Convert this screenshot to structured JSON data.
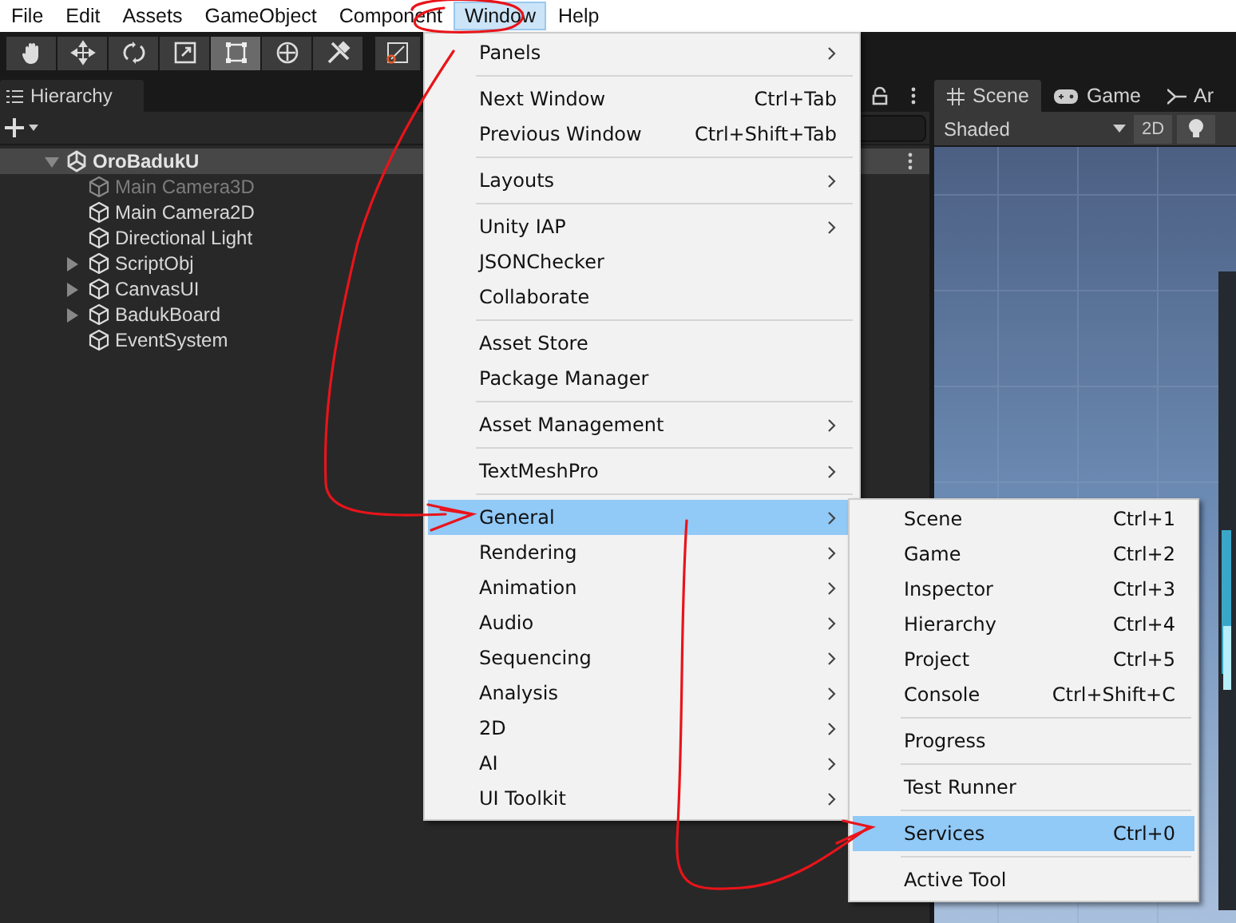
{
  "menubar": [
    {
      "label": "File",
      "selected": false
    },
    {
      "label": "Edit",
      "selected": false
    },
    {
      "label": "Assets",
      "selected": false
    },
    {
      "label": "GameObject",
      "selected": false
    },
    {
      "label": "Component",
      "selected": false
    },
    {
      "label": "Window",
      "selected": true
    },
    {
      "label": "Help",
      "selected": false
    }
  ],
  "toolbar": {
    "tools": [
      {
        "kind": "hand",
        "selected": false
      },
      {
        "kind": "move",
        "selected": false
      },
      {
        "kind": "rotate",
        "selected": false
      },
      {
        "kind": "scale",
        "selected": false
      },
      {
        "kind": "rect",
        "selected": true
      },
      {
        "kind": "transform",
        "selected": false
      },
      {
        "kind": "custom",
        "selected": false
      }
    ]
  },
  "hierarchy": {
    "tab": "Hierarchy",
    "root": {
      "label": "OroBadukU",
      "expanded": true,
      "children": [
        {
          "label": "Main Camera3D",
          "disabled": true,
          "expandable": false
        },
        {
          "label": "Main Camera2D",
          "disabled": false,
          "expandable": false
        },
        {
          "label": "Directional Light",
          "disabled": false,
          "expandable": false
        },
        {
          "label": "ScriptObj",
          "disabled": false,
          "expandable": true
        },
        {
          "label": "CanvasUI",
          "disabled": false,
          "expandable": true
        },
        {
          "label": "BadukBoard",
          "disabled": false,
          "expandable": true
        },
        {
          "label": "EventSystem",
          "disabled": false,
          "expandable": false
        }
      ]
    }
  },
  "scene_view": {
    "tabs": [
      {
        "label": "Scene",
        "kind": "scene",
        "selected": true
      },
      {
        "label": "Game",
        "kind": "game",
        "selected": false
      },
      {
        "label": "Ar",
        "kind": "animator",
        "selected": false
      }
    ],
    "shading": "Shaded",
    "mode_button": "2D"
  },
  "window_menu": {
    "sections": [
      [
        {
          "label": "Panels",
          "submenu": true,
          "selected": false
        }
      ],
      [
        {
          "label": "Next Window",
          "shortcut": "Ctrl+Tab",
          "submenu": false,
          "selected": false
        },
        {
          "label": "Previous Window",
          "shortcut": "Ctrl+Shift+Tab",
          "submenu": false,
          "selected": false
        }
      ],
      [
        {
          "label": "Layouts",
          "submenu": true,
          "selected": false
        }
      ],
      [
        {
          "label": "Unity IAP",
          "submenu": true,
          "selected": false
        },
        {
          "label": "JSONChecker",
          "submenu": false,
          "selected": false
        },
        {
          "label": "Collaborate",
          "submenu": false,
          "selected": false
        }
      ],
      [
        {
          "label": "Asset Store",
          "submenu": false,
          "selected": false
        },
        {
          "label": "Package Manager",
          "submenu": false,
          "selected": false
        }
      ],
      [
        {
          "label": "Asset Management",
          "submenu": true,
          "selected": false
        }
      ],
      [
        {
          "label": "TextMeshPro",
          "submenu": true,
          "selected": false
        }
      ],
      [
        {
          "label": "General",
          "submenu": true,
          "selected": true
        },
        {
          "label": "Rendering",
          "submenu": true,
          "selected": false
        },
        {
          "label": "Animation",
          "submenu": true,
          "selected": false
        },
        {
          "label": "Audio",
          "submenu": true,
          "selected": false
        },
        {
          "label": "Sequencing",
          "submenu": true,
          "selected": false
        },
        {
          "label": "Analysis",
          "submenu": true,
          "selected": false
        },
        {
          "label": "2D",
          "submenu": true,
          "selected": false
        },
        {
          "label": "AI",
          "submenu": true,
          "selected": false
        },
        {
          "label": "UI Toolkit",
          "submenu": true,
          "selected": false
        }
      ]
    ]
  },
  "general_submenu": {
    "sections": [
      [
        {
          "label": "Scene",
          "shortcut": "Ctrl+1",
          "selected": false
        },
        {
          "label": "Game",
          "shortcut": "Ctrl+2",
          "selected": false
        },
        {
          "label": "Inspector",
          "shortcut": "Ctrl+3",
          "selected": false
        },
        {
          "label": "Hierarchy",
          "shortcut": "Ctrl+4",
          "selected": false
        },
        {
          "label": "Project",
          "shortcut": "Ctrl+5",
          "selected": false
        },
        {
          "label": "Console",
          "shortcut": "Ctrl+Shift+C",
          "selected": false
        }
      ],
      [
        {
          "label": "Progress",
          "selected": false
        }
      ],
      [
        {
          "label": "Test Runner",
          "selected": false
        }
      ],
      [
        {
          "label": "Services",
          "shortcut": "Ctrl+0",
          "selected": true
        }
      ],
      [
        {
          "label": "Active Tool",
          "selected": false
        }
      ]
    ]
  }
}
